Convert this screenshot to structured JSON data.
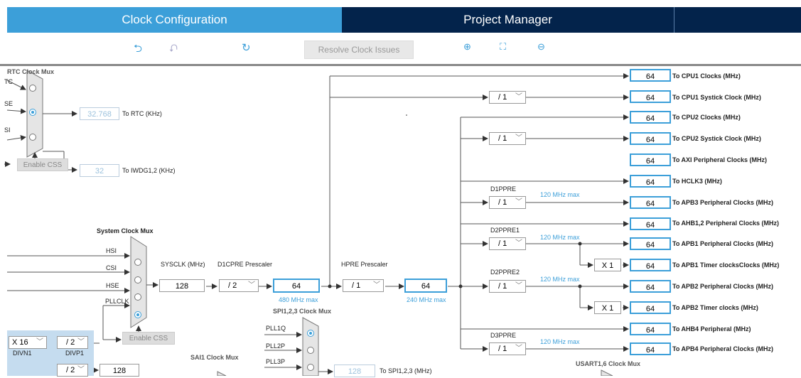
{
  "tabs": [
    {
      "label": "Clock Configuration"
    },
    {
      "label": "Project Manager"
    }
  ],
  "toolbar": {
    "undo_icon": "undo-icon",
    "redo_icon": "redo-icon",
    "reset_icon": "refresh-icon",
    "resolve_label": "Resolve Clock Issues",
    "zoom_in_icon": "zoom-in-icon",
    "fit_icon": "fit-screen-icon",
    "zoom_out_icon": "zoom-out-icon"
  },
  "rtc": {
    "title": "RTC Clock Mux",
    "inputs": [
      "LSI",
      "LSE",
      "HSE"
    ],
    "rtc_value": "32.768",
    "rtc_label": "To RTC (KHz)",
    "iwdg_value": "32",
    "iwdg_label": "To IWDG1,2 (KHz)",
    "enable_css": "Enable CSS"
  },
  "sysmux": {
    "title": "System Clock Mux",
    "inputs": [
      "HSI",
      "CSI",
      "HSE",
      "PLLCLK"
    ],
    "enable_css": "Enable CSS"
  },
  "sysclk": {
    "label": "SYSCLK (MHz)",
    "value": "128"
  },
  "d1cpre": {
    "label": "D1CPRE Prescaler",
    "value": "/ 2",
    "out": "64",
    "max": "480 MHz max"
  },
  "hpre": {
    "label": "HPRE Prescaler",
    "value": "/ 1",
    "out": "64",
    "max": "240 MHz max"
  },
  "pll": {
    "mul": "X 16",
    "divn": "DIVN1",
    "p": "/ 2",
    "divp": "DIVP1",
    "q": "/ 2",
    "q_out": "128"
  },
  "spi_mux": {
    "title": "SPI1,2,3 Clock Mux",
    "inputs": [
      "PLL1Q",
      "PLL2P",
      "PLL3P"
    ],
    "value": "128",
    "label": "To SPI1,2,3 (MHz)"
  },
  "sai_mux": {
    "title": "SAI1 Clock Mux"
  },
  "usart_mux": {
    "title": "USART1,6 Clock Mux"
  },
  "outputs": [
    {
      "value": "64",
      "label": "To CPU1 Clocks (MHz)"
    },
    {
      "value": "64",
      "label": "To CPU1 Systick Clock (MHz)",
      "div": "/ 1"
    },
    {
      "value": "64",
      "label": "To CPU2 Clocks (MHz)"
    },
    {
      "value": "64",
      "label": "To CPU2 Systick Clock (MHz)",
      "div": "/ 1"
    },
    {
      "value": "64",
      "label": "To AXI Peripheral Clocks (MHz)"
    },
    {
      "value": "64",
      "label": "To HCLK3 (MHz)"
    },
    {
      "value": "64",
      "label": "To APB3 Peripheral Clocks (MHz)",
      "div": "/ 1",
      "pre": "D1PPRE",
      "max": "120 MHz max"
    },
    {
      "value": "64",
      "label": "To AHB1,2 Peripheral Clocks (MHz)"
    },
    {
      "value": "64",
      "label": "To APB1 Peripheral Clocks (MHz)",
      "div": "/ 1",
      "pre": "D2PPRE1",
      "max": "120 MHz max"
    },
    {
      "value": "64",
      "label": "To APB1 Timer clocksClocks (MHz)",
      "mul": "X 1"
    },
    {
      "value": "64",
      "label": "To APB2 Peripheral Clocks (MHz)",
      "div": "/ 1",
      "pre": "D2PPRE2",
      "max": "120 MHz max"
    },
    {
      "value": "64",
      "label": "To APB2 Timer clocks (MHz)",
      "mul": "X 1"
    },
    {
      "value": "64",
      "label": "To AHB4 Peripheral (MHz)"
    },
    {
      "value": "64",
      "label": "To APB4 Peripheral Clocks (MHz)",
      "div": "/ 1",
      "pre": "D3PPRE",
      "max": "120 MHz max"
    }
  ]
}
